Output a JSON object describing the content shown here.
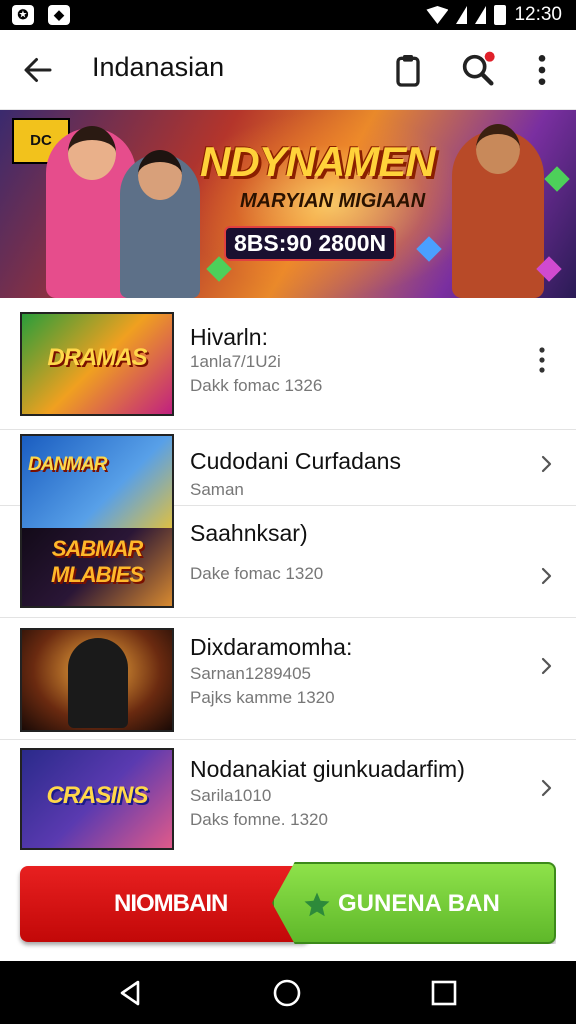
{
  "status_bar": {
    "time": "12:30",
    "icons": [
      "app-icon",
      "cat-icon"
    ]
  },
  "app_bar": {
    "title": "Indanasian",
    "back_icon": "arrow-left-icon",
    "actions": [
      "clipboard-icon",
      "search-icon",
      "more-vert-icon"
    ]
  },
  "banner": {
    "badge": "DC",
    "title": "NDYNAMEN",
    "subtitle": "MARYIAN MIGIAAN",
    "code": "8BS:90 2800N"
  },
  "list": {
    "items": [
      {
        "thumb_text": "DRAMAS",
        "title": "Hivarln:",
        "line1": "1anla7/1U2i",
        "line2": "Dakk fomac 1326",
        "action": "more-vert-icon"
      },
      {
        "thumb_text": "DANMAR",
        "title": "Cudodani Curfadans",
        "line1": "Saman",
        "action": "chevron-right-icon"
      },
      {
        "thumb_text": "SABMAR MLABIES",
        "title": "Saahnksar)",
        "line2": "Dake fomac 1320",
        "action": "chevron-right-icon"
      },
      {
        "thumb_text": "",
        "title": "Dixdaramomha:",
        "line1": "Sarnan1289405",
        "line2": "Pajks kamme 1320",
        "action": "chevron-right-icon"
      },
      {
        "thumb_text": "CRASINS",
        "title": "Nodanakiat giunkuadarfim)",
        "line1": "Sarila1010",
        "line2": "Daks fomne. 1320",
        "action": "chevron-right-icon"
      }
    ]
  },
  "cta": {
    "primary": "NIOMBAIN",
    "secondary": "GUNENA BAN"
  },
  "colors": {
    "red": "#d81414",
    "green": "#6cc334",
    "banner_title": "#ffd23a"
  },
  "nav_bar": {
    "buttons": [
      "back-triangle-icon",
      "home-circle-icon",
      "recents-square-icon"
    ]
  }
}
